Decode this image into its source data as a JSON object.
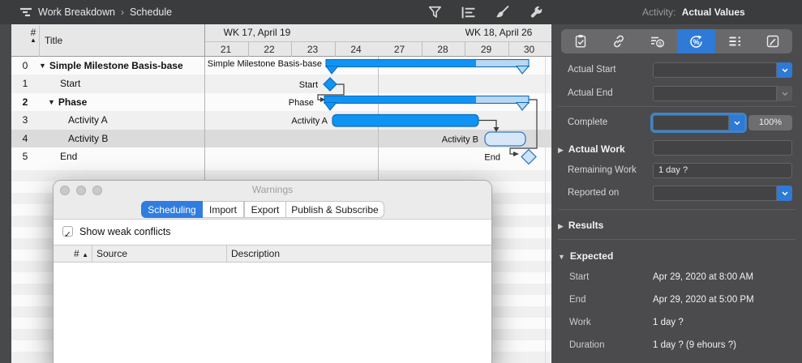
{
  "colors": {
    "accent_blue": "#1094f4",
    "bar_border": "#0b6dbd",
    "incomplete_fill": "#b9d7f3",
    "selected_tab_blue": "#2e7ad6",
    "toolbar_bg": "#3b3c3e",
    "panel_bg": "#4b4b4d"
  },
  "toolbar": {
    "breadcrumb": {
      "path0": "Work Breakdown",
      "separator": "›",
      "path1": "Schedule"
    },
    "actions": [
      "filter-icon",
      "align-lines-icon",
      "brush-icon",
      "wrench-icon"
    ],
    "inspector_header": {
      "label": "Activity:",
      "value": "Actual Values"
    }
  },
  "outline": {
    "header": {
      "number": "#",
      "sort": "▲",
      "title": "Title"
    },
    "rows": [
      {
        "num": "0",
        "title": "Simple Milestone Basis-base",
        "disclosure": "▼"
      },
      {
        "num": "1",
        "title": "Start"
      },
      {
        "num": "2",
        "title": "Phase",
        "disclosure": "▼"
      },
      {
        "num": "3",
        "title": "Activity A"
      },
      {
        "num": "4",
        "title": "Activity B"
      },
      {
        "num": "5",
        "title": "End"
      }
    ]
  },
  "timeline": {
    "weeks": [
      {
        "label": "WK 17, April 19",
        "days": [
          "21",
          "22",
          "23",
          "24"
        ]
      },
      {
        "label": "WK 18, April 26",
        "days": [
          "27",
          "28",
          "29",
          "30"
        ]
      }
    ]
  },
  "gantt": {
    "bars": [
      {
        "label": "Simple Milestone Basis-base",
        "type": "group",
        "state": "partially-complete"
      },
      {
        "label": "Start",
        "type": "milestone",
        "state": "complete"
      },
      {
        "label": "Phase",
        "type": "group",
        "state": "partially-complete"
      },
      {
        "label": "Activity A",
        "type": "task",
        "state": "complete"
      },
      {
        "label": "Activity B",
        "type": "task",
        "state": "not-started"
      },
      {
        "label": "End",
        "type": "milestone",
        "state": "not-started"
      }
    ]
  },
  "warnings_dialog": {
    "title": "Warnings",
    "tabs": [
      {
        "label": "Scheduling",
        "selected": true
      },
      {
        "label": "Import",
        "selected": false
      },
      {
        "label": "Export",
        "selected": false
      },
      {
        "label": "Publish & Subscribe",
        "selected": false
      }
    ],
    "show_weak_conflicts": {
      "label": "Show weak conflicts",
      "checked": true,
      "checkmark": "✓"
    },
    "table": {
      "number": "#",
      "sort": "▲",
      "source": "Source",
      "description": "Description",
      "rows": []
    }
  },
  "inspector": {
    "tabs": [
      "clipboard-check-icon",
      "link-icon",
      "resource-cost-icon",
      "percent-cycle-icon",
      "custom-data-icon",
      "note-edit-icon"
    ],
    "selected_tab": 3,
    "fields": {
      "actual_start": {
        "label": "Actual Start",
        "value": ""
      },
      "actual_end": {
        "label": "Actual End",
        "value": ""
      },
      "complete": {
        "label": "Complete",
        "value": "",
        "button": "100%"
      },
      "actual_work": {
        "label": "Actual Work",
        "value": "",
        "disclosure": "▶"
      },
      "remaining_work": {
        "label": "Remaining Work",
        "value": "1 day ?"
      },
      "reported_on": {
        "label": "Reported on",
        "value": ""
      }
    },
    "sections": {
      "results": {
        "label": "Results",
        "disclosure": "▶"
      },
      "expected": {
        "label": "Expected",
        "disclosure": "▼",
        "rows": [
          {
            "label": "Start",
            "value": "Apr 29, 2020 at 8:00 AM"
          },
          {
            "label": "End",
            "value": "Apr 29, 2020 at 5:00 PM"
          },
          {
            "label": "Work",
            "value": "1 day ?"
          },
          {
            "label": "Duration",
            "value": "1 day ? (9 ehours ?)"
          }
        ]
      }
    }
  }
}
